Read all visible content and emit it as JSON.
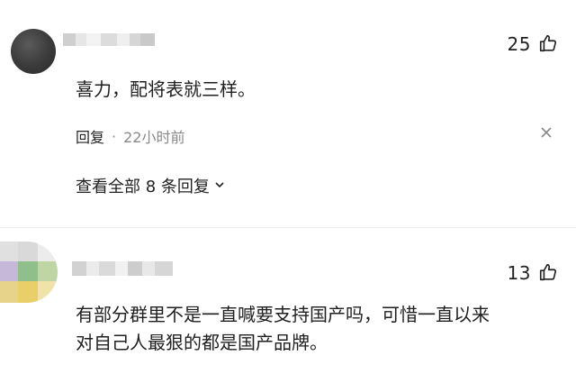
{
  "comments": [
    {
      "likes": "25",
      "text": "喜力，配将表就三样。",
      "reply_label": "回复",
      "time_separator": "·",
      "time": "22小时前",
      "view_all_label": "查看全部 8 条回复"
    },
    {
      "likes": "13",
      "text_lines": [
        "有部分群里不是一直喊要支持国产吗，可惜一直以来",
        "对自己人最狠的都是国产品牌。"
      ]
    }
  ],
  "icons": {
    "like": "thumbs-up-icon",
    "close": "close-icon",
    "expand": "chevron-down-icon"
  },
  "colors": {
    "text": "#1f1f1f",
    "secondary": "#888888",
    "background": "#ffffff"
  }
}
